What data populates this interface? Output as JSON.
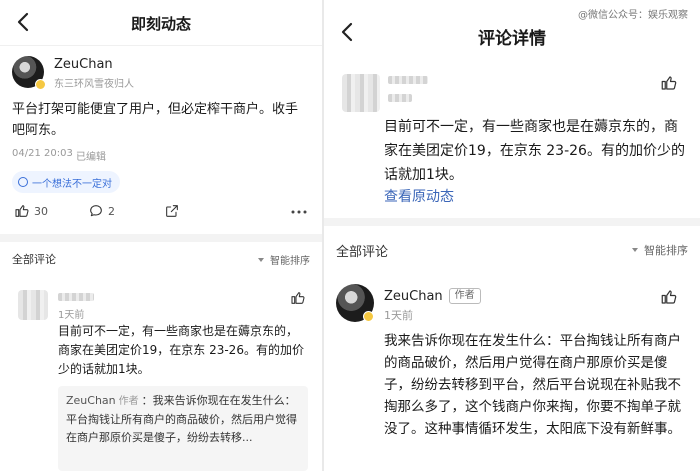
{
  "watermark": "@微信公众号：娱乐观察",
  "left": {
    "nav_title": "即刻动态",
    "post": {
      "author": "ZeuChan",
      "bio": "东三环风雪夜归人",
      "text": "平台打架可能便宜了用户，但必定榨干商户。收手吧阿东。",
      "time": "04/21 20:03",
      "edited": "已编辑",
      "opinion": "一个想法不一定对",
      "likes": "30",
      "comments": "2"
    },
    "comments_header": "全部评论",
    "sort_label": "智能排序",
    "comment": {
      "time": "1天前",
      "text": "目前可不一定，有一些商家也是在薅京东的，商家在美团定价19，在京东 23-26。有的加价少的话就加1块。",
      "reply_name": "ZeuChan",
      "reply_tag": "作者",
      "reply_text": "：我来告诉你现在在发生什么：平台掏钱让所有商户的商品破价，然后用户觉得在商户那原价买是傻子，纷纷去转移..."
    }
  },
  "right": {
    "nav_title": "评论详情",
    "comment": {
      "text": "目前可不一定，有一些商家也是在薅京东的，商家在美团定价19，在京东 23-26。有的加价少的话就加1块。",
      "view_original": "查看原动态"
    },
    "comments_header": "全部评论",
    "sort_label": "智能排序",
    "reply": {
      "author": "ZeuChan",
      "author_tag": "作者",
      "time": "1天前",
      "text": "我来告诉你现在在发生什么：平台掏钱让所有商户的商品破价，然后用户觉得在商户那原价买是傻子，纷纷去转移到平台，然后平台说现在补贴我不掏那么多了，这个钱商户你来掏，你要不掏单子就没了。这种事情循环发生，太阳底下没有新鲜事。"
    }
  },
  "colors": {
    "link": "#3b66b8",
    "opinion": "#3a6fd8",
    "badge": "#f5c842"
  }
}
